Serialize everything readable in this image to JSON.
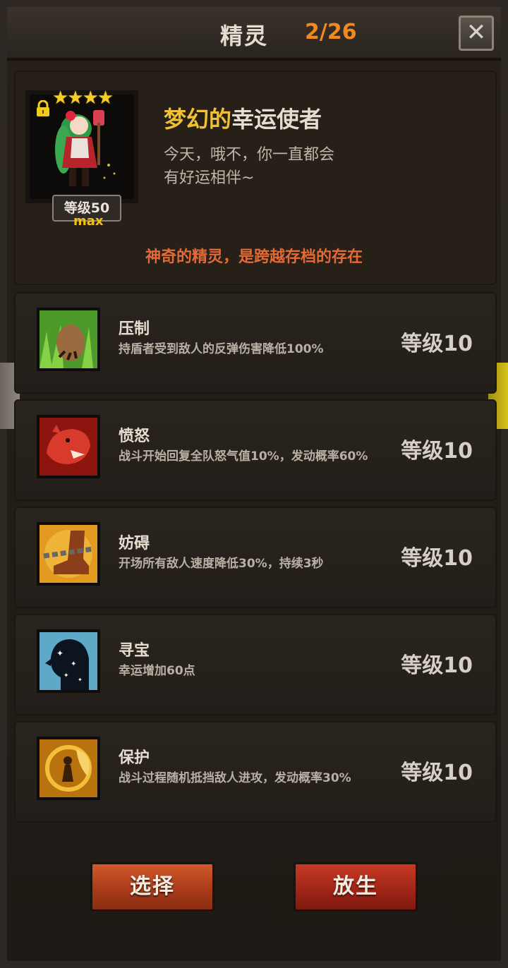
{
  "header": {
    "title": "精灵",
    "count": "2/26",
    "close_icon": "close-icon"
  },
  "spirit": {
    "stars": "★★★★",
    "star_count": 4,
    "locked": true,
    "level_label": "等级50",
    "level_max": "max",
    "name_highlight": "梦幻的",
    "name_rest": "幸运使者",
    "description_line1": "今天，哦不，你一直都会",
    "description_line2": "有好运相伴~",
    "note": "神奇的精灵，是跨越存档的存在"
  },
  "skills": [
    {
      "name": "压制",
      "desc": "持盾者受到敌人的反弹伤害降低100%",
      "level": "等级10",
      "icon": "paw-grass-icon"
    },
    {
      "name": "愤怒",
      "desc": "战斗开始回复全队怒气值10%，发动概率60%",
      "level": "等级10",
      "icon": "roaring-beast-icon"
    },
    {
      "name": "妨碍",
      "desc": "开场所有敌人速度降低30%，持续3秒",
      "level": "等级10",
      "icon": "chained-boot-icon"
    },
    {
      "name": "寻宝",
      "desc": "幸运增加60点",
      "level": "等级10",
      "icon": "sparkle-silhouette-icon"
    },
    {
      "name": "保护",
      "desc": "战斗过程随机抵挡敌人进攻，发动概率30%",
      "level": "等级10",
      "icon": "fairy-shield-icon"
    }
  ],
  "buttons": {
    "select": "选择",
    "release": "放生"
  },
  "colors": {
    "accent_orange": "#f08a1c",
    "name_gold": "#f0c233",
    "note_red": "#e36a35",
    "select_button": "#a53a18",
    "release_button": "#9c2416"
  }
}
